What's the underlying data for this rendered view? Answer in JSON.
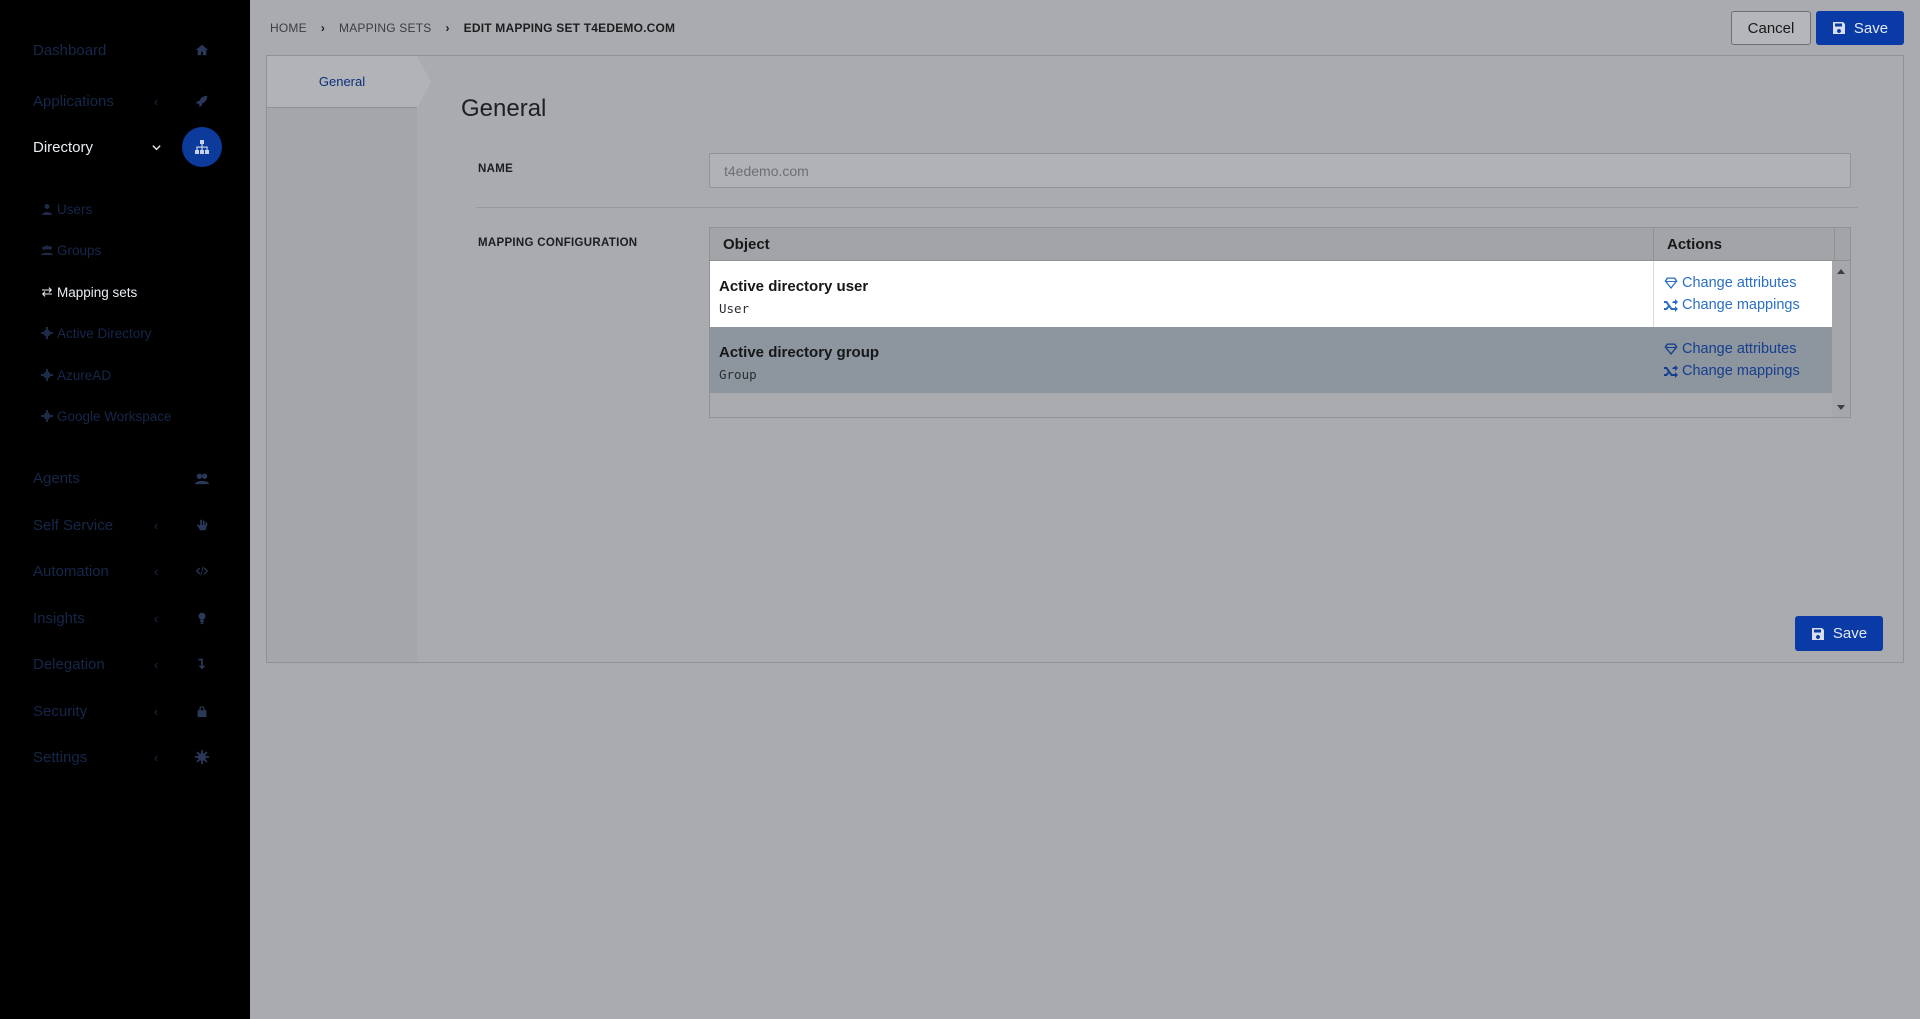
{
  "sidebar": {
    "items": [
      {
        "label": "Dashboard",
        "icon": "home-icon"
      },
      {
        "label": "Applications",
        "icon": "rocket-icon"
      },
      {
        "label": "Directory",
        "icon": "sitemap-icon"
      },
      {
        "label": "Agents",
        "icon": "agents-icon"
      },
      {
        "label": "Self Service",
        "icon": "hand-icon"
      },
      {
        "label": "Automation",
        "icon": "code-icon"
      },
      {
        "label": "Insights",
        "icon": "lightbulb-icon"
      },
      {
        "label": "Delegation",
        "icon": "delegation-icon"
      },
      {
        "label": "Security",
        "icon": "lock-icon"
      },
      {
        "label": "Settings",
        "icon": "gear-icon"
      }
    ],
    "directory_sub": [
      {
        "label": "Users",
        "icon": "user-icon"
      },
      {
        "label": "Groups",
        "icon": "users-icon"
      },
      {
        "label": "Mapping sets",
        "icon": "exchange-icon"
      },
      {
        "label": "Active Directory",
        "icon": "gear-icon"
      },
      {
        "label": "AzureAD",
        "icon": "gear-icon"
      },
      {
        "label": "Google Workspace",
        "icon": "gear-icon"
      }
    ]
  },
  "breadcrumb": {
    "home": "HOME",
    "mapping_sets": "MAPPING SETS",
    "current": "EDIT MAPPING SET T4EDEMO.COM"
  },
  "toolbar": {
    "cancel_label": "Cancel",
    "save_label": "Save"
  },
  "tabs": {
    "general": "General"
  },
  "form": {
    "title": "General",
    "name_label": "NAME",
    "name_value": "t4edemo.com",
    "mapping_label": "MAPPING CONFIGURATION"
  },
  "table": {
    "col_object": "Object",
    "col_actions": "Actions",
    "rows": [
      {
        "name": "Active directory user",
        "type": "User",
        "action1": "Change attributes",
        "action2": "Change mappings"
      },
      {
        "name": "Active directory group",
        "type": "Group",
        "action1": "Change attributes",
        "action2": "Change mappings"
      }
    ]
  },
  "colors": {
    "accent": "#0a3aa6",
    "link": "#2a6fc4",
    "sidebar_bg": "#000000"
  }
}
